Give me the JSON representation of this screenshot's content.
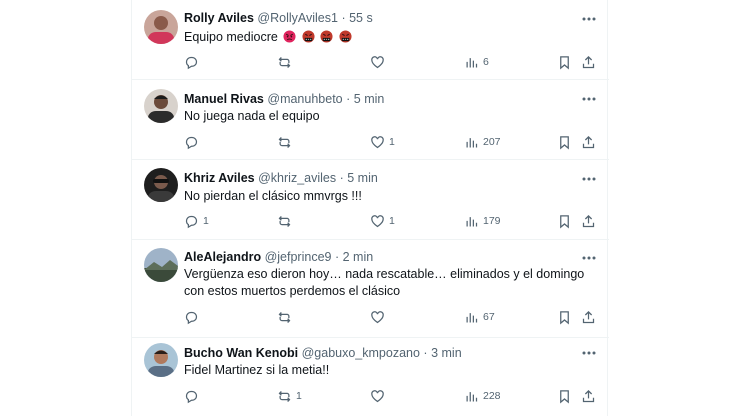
{
  "tweets": [
    {
      "name": "Rolly Aviles",
      "handle": "@RollyAviles1",
      "dot": "·",
      "time": "55 s",
      "text": "Equipo mediocre",
      "emojis": [
        "angry-face",
        "cursing-face",
        "cursing-face",
        "cursing-face"
      ],
      "replies": "",
      "retweets": "",
      "likes": "",
      "views": "6"
    },
    {
      "name": "Manuel Rivas",
      "handle": "@manuhbeto",
      "dot": "·",
      "time": "5 min",
      "text": "No juega nada el equipo",
      "emojis": [],
      "replies": "",
      "retweets": "",
      "likes": "1",
      "views": "207"
    },
    {
      "name": "Khriz Aviles",
      "handle": "@khriz_aviles",
      "dot": "·",
      "time": "5 min",
      "text": "No pierdan el clásico mmvrgs !!!",
      "emojis": [],
      "replies": "1",
      "retweets": "",
      "likes": "1",
      "views": "179"
    },
    {
      "name": "AleAlejandro",
      "handle": "@jefprince9",
      "dot": "·",
      "time": "2 min",
      "text": "Vergüenza eso dieron hoy… nada rescatable… eliminados y el domingo con estos muertos perdemos el clásico",
      "emojis": [],
      "replies": "",
      "retweets": "",
      "likes": "",
      "views": "67"
    },
    {
      "name": "Bucho Wan Kenobi",
      "handle": "@gabuxo_kmpozano",
      "dot": "·",
      "time": "3 min",
      "text": "Fidel Martinez si la metia!!",
      "emojis": [],
      "replies": "",
      "retweets": "1",
      "likes": "",
      "views": "228"
    }
  ],
  "colors": {
    "text": "#0f1419",
    "muted": "#536471",
    "divider": "#eff3f4",
    "angry": "#e0245e",
    "cursing": "#c0392b"
  }
}
